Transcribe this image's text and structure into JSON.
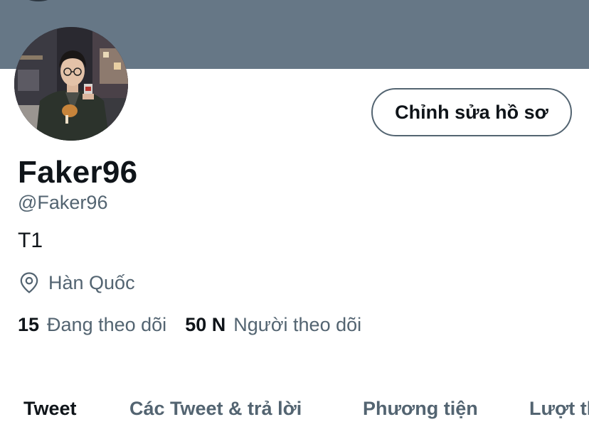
{
  "profile": {
    "edit_button_label": "Chỉnh sửa hồ sơ",
    "display_name": "Faker96",
    "handle": "@Faker96",
    "bio": "T1",
    "location": "Hàn Quốc",
    "following": {
      "count": "15",
      "label": "Đang theo dõi"
    },
    "followers": {
      "count": "50 N",
      "label": "Người theo dõi"
    }
  },
  "tabs": [
    {
      "label": "Tweet",
      "active": true
    },
    {
      "label": "Các Tweet & trả lời",
      "active": false
    },
    {
      "label": "Phương tiện",
      "active": false
    },
    {
      "label": "Lượt thích",
      "active": false
    }
  ],
  "icons": {
    "location": "map-pin-icon"
  },
  "colors": {
    "banner": "#667786",
    "primary_text": "#0f1419",
    "secondary_text": "#536471"
  }
}
